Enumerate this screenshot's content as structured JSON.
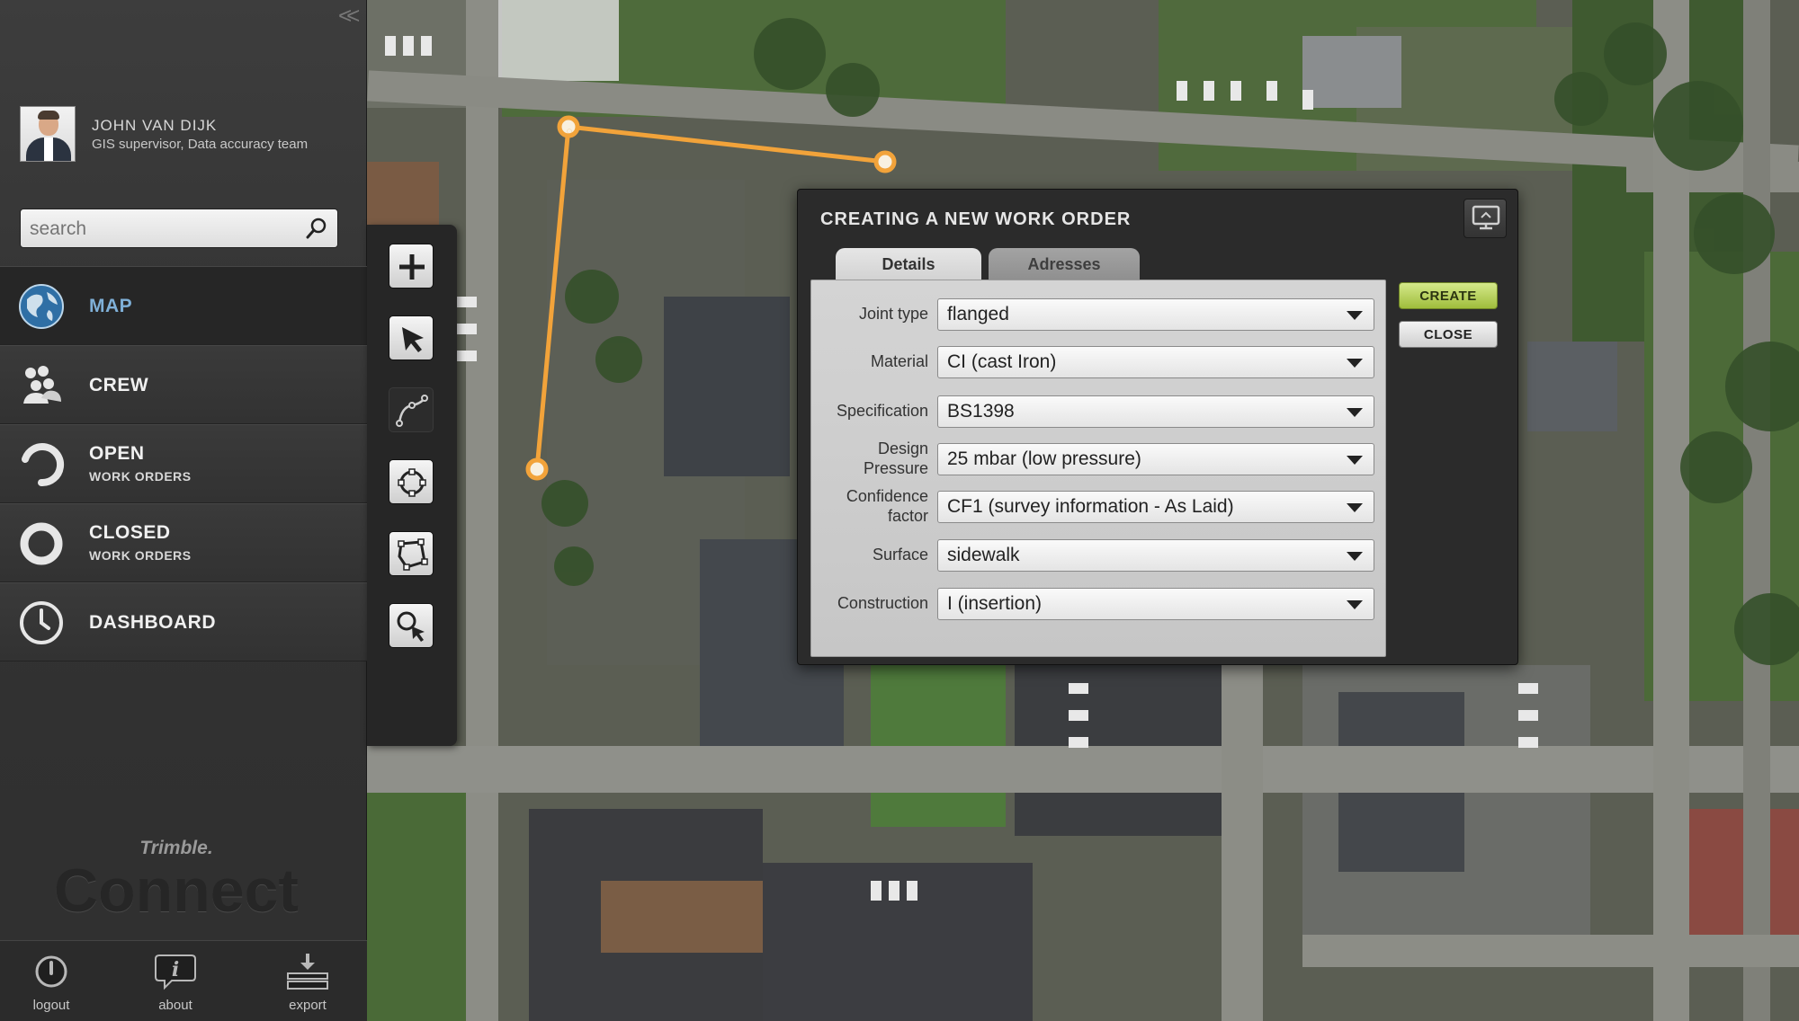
{
  "user": {
    "name": "JOHN VAN DIJK",
    "role": "GIS supervisor, Data accuracy team"
  },
  "search": {
    "placeholder": "search"
  },
  "nav": [
    {
      "label": "MAP",
      "sub": ""
    },
    {
      "label": "CREW",
      "sub": ""
    },
    {
      "label": "OPEN",
      "sub": "WORK ORDERS"
    },
    {
      "label": "CLOSED",
      "sub": "WORK ORDERS"
    },
    {
      "label": "DASHBOARD",
      "sub": ""
    }
  ],
  "brand": {
    "small": "Trimble.",
    "big": "Connect"
  },
  "footer": {
    "logout": "logout",
    "about": "about",
    "export": "export"
  },
  "tools": [
    "add-icon",
    "pointer-icon",
    "polyline-icon",
    "circle-icon",
    "polygon-icon",
    "zoom-select-icon"
  ],
  "dialog": {
    "title": "CREATING A NEW WORK ORDER",
    "tabs": [
      "Details",
      "Adresses"
    ],
    "create": "CREATE",
    "close": "CLOSE",
    "fields": [
      {
        "label": "Joint type",
        "value": "flanged"
      },
      {
        "label": "Material",
        "value": "CI (cast Iron)"
      },
      {
        "label": "Specification",
        "value": "BS1398"
      },
      {
        "label": "Design Pressure",
        "value": "25 mbar (low pressure)"
      },
      {
        "label": "Confidence factor",
        "value": "CF1 (survey information - As Laid)"
      },
      {
        "label": "Surface",
        "value": "sidewalk"
      },
      {
        "label": "Construction",
        "value": "I (insertion)"
      }
    ]
  },
  "colors": {
    "accent_blue": "#7fb0d8",
    "create_green": "#b5d25a",
    "route_orange": "#f2a33a"
  }
}
